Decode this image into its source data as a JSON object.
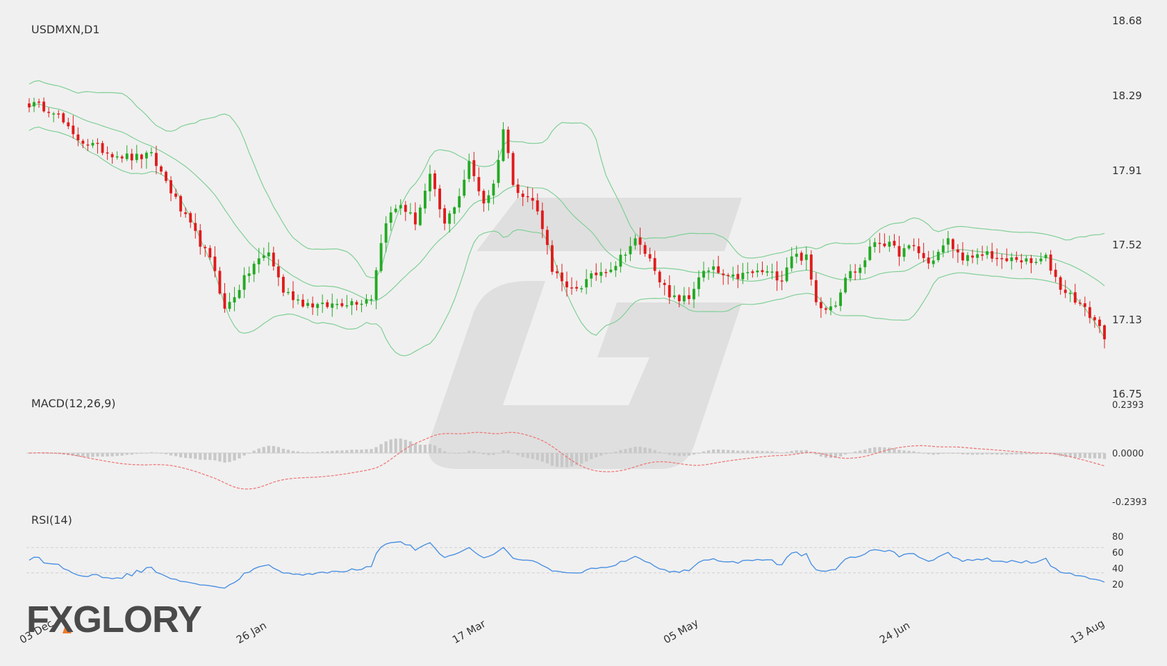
{
  "chart_data": {
    "type": "candlestick",
    "title": "USDMXN,D1",
    "symbol": "USDMXN",
    "timeframe": "D1",
    "x_ticks": [
      "03 Dec",
      "26 Jan",
      "17 Mar",
      "05 May",
      "24 Jun",
      "13 Aug"
    ],
    "price_axis": {
      "ticks": [
        "18.68",
        "18.29",
        "17.91",
        "17.52",
        "17.13",
        "16.75"
      ],
      "ylim": [
        16.75,
        18.68
      ]
    },
    "colors": {
      "up": "#22aa22",
      "down": "#e01b1b",
      "bollinger": "#7fcf95",
      "macd_signal": "#f07070",
      "macd_hist": "#c8c8c8",
      "rsi": "#4a90e2",
      "grid": "#cfcfcf",
      "text": "#333333"
    },
    "price_anchors": [
      [
        0,
        18.25
      ],
      [
        5,
        18.22
      ],
      [
        9,
        18.08
      ],
      [
        16,
        18.0
      ],
      [
        21,
        17.97
      ],
      [
        25,
        17.98
      ],
      [
        28,
        17.85
      ],
      [
        31,
        17.7
      ],
      [
        35,
        17.53
      ],
      [
        38,
        17.39
      ],
      [
        40,
        17.18
      ],
      [
        43,
        17.3
      ],
      [
        46,
        17.42
      ],
      [
        49,
        17.48
      ],
      [
        52,
        17.28
      ],
      [
        56,
        17.22
      ],
      [
        60,
        17.2
      ],
      [
        64,
        17.22
      ],
      [
        68,
        17.23
      ],
      [
        70,
        17.25
      ],
      [
        71,
        17.4
      ],
      [
        73,
        17.65
      ],
      [
        76,
        17.73
      ],
      [
        79,
        17.64
      ],
      [
        82,
        17.87
      ],
      [
        85,
        17.62
      ],
      [
        88,
        17.78
      ],
      [
        90,
        17.94
      ],
      [
        93,
        17.74
      ],
      [
        95,
        17.83
      ],
      [
        97,
        18.12
      ],
      [
        99,
        17.85
      ],
      [
        101,
        17.77
      ],
      [
        103,
        17.75
      ],
      [
        105,
        17.62
      ],
      [
        107,
        17.4
      ],
      [
        110,
        17.28
      ],
      [
        113,
        17.31
      ],
      [
        116,
        17.37
      ],
      [
        120,
        17.42
      ],
      [
        122,
        17.49
      ],
      [
        124,
        17.54
      ],
      [
        126,
        17.48
      ],
      [
        128,
        17.4
      ],
      [
        131,
        17.24
      ],
      [
        135,
        17.24
      ],
      [
        137,
        17.36
      ],
      [
        140,
        17.39
      ],
      [
        143,
        17.34
      ],
      [
        147,
        17.37
      ],
      [
        150,
        17.38
      ],
      [
        154,
        17.35
      ],
      [
        156,
        17.47
      ],
      [
        159,
        17.45
      ],
      [
        161,
        17.22
      ],
      [
        163,
        17.2
      ],
      [
        165,
        17.22
      ],
      [
        167,
        17.36
      ],
      [
        170,
        17.4
      ],
      [
        173,
        17.54
      ],
      [
        175,
        17.53
      ],
      [
        178,
        17.48
      ],
      [
        181,
        17.51
      ],
      [
        184,
        17.42
      ],
      [
        188,
        17.54
      ],
      [
        190,
        17.47
      ],
      [
        193,
        17.44
      ],
      [
        196,
        17.48
      ],
      [
        199,
        17.43
      ],
      [
        202,
        17.45
      ],
      [
        205,
        17.42
      ],
      [
        208,
        17.45
      ],
      [
        211,
        17.3
      ],
      [
        214,
        17.24
      ],
      [
        216,
        17.18
      ],
      [
        218,
        17.13
      ],
      [
        220,
        17.05
      ]
    ],
    "bollinger_period": 20,
    "bollinger_stddev": 2,
    "macd": {
      "label": "MACD(12,26,9)",
      "params": [
        12,
        26,
        9
      ],
      "ticks": [
        "0.2393",
        "0.0000",
        "-0.2393"
      ],
      "ylim": [
        -0.2393,
        0.2393
      ]
    },
    "rsi": {
      "label": "RSI(14)",
      "period": 14,
      "ticks": [
        "80",
        "60",
        "40",
        "20"
      ],
      "ylim": [
        0,
        100
      ],
      "levels": [
        70,
        30
      ]
    }
  },
  "branding": {
    "logo_text": "FXGLORY"
  }
}
